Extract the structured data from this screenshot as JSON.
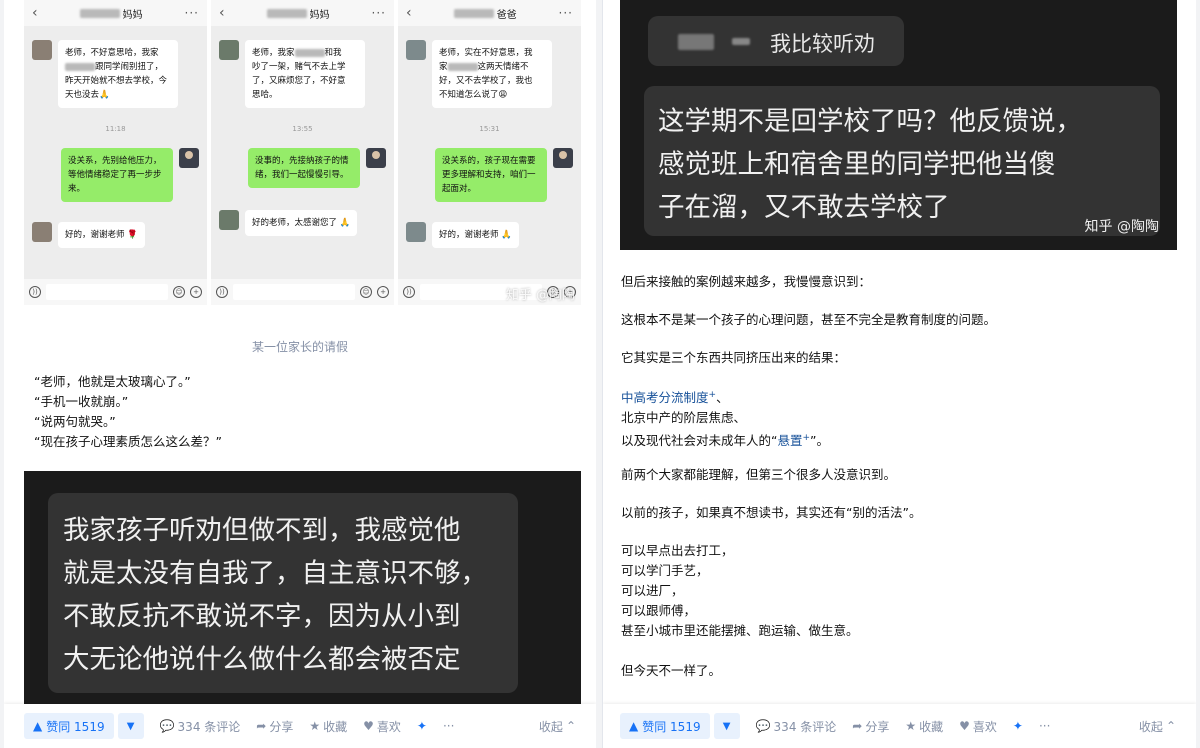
{
  "left": {
    "chats": [
      {
        "title_suffix": "妈妈",
        "parent_msg": [
          "老师，不好意思哈，我家",
          "跟同学闹别扭了，",
          "昨天开始就不想去学校，今",
          "天也没去🙏"
        ],
        "time": "11:18",
        "teacher_msg": [
          "没关系，先别给他压力，",
          "等他情绪稳定了再一步步",
          "来。"
        ],
        "parent_reply": "好的，谢谢老师 🌹"
      },
      {
        "title_suffix": "妈妈",
        "parent_msg": [
          "老师，我家",
          "和我",
          "吵了一架，赌气不去上学",
          "了，又麻烦您了，不好意",
          "思哈。"
        ],
        "time": "13:55",
        "teacher_msg": [
          "没事的，先接纳孩子的情",
          "绪，我们一起慢慢引导。"
        ],
        "parent_reply": "好的老师，太感谢您了 🙏"
      },
      {
        "title_suffix": "爸爸",
        "parent_msg": [
          "老师，实在不好意思，我",
          "家",
          "这两天情绪不",
          "好，又不去学校了，我也",
          "不知道怎么说了😩"
        ],
        "time": "15:31",
        "teacher_msg": [
          "没关系的，孩子现在需要",
          "更多理解和支持，咱们一",
          "起面对。"
        ],
        "parent_reply": "好的，谢谢老师 🙏"
      }
    ],
    "watermark": "知乎 @陶陶",
    "caption": "某一位家长的请假",
    "quotes": [
      "“老师，他就是太玻璃心了。”",
      "“手机一收就崩。”",
      "“说两句就哭。”",
      "“现在孩子心理素质怎么这么差？”"
    ],
    "dark_lines": [
      "我家孩子听劝但做不到，我感觉他",
      "就是太没有自我了，自主意识不够，",
      "不敢反抗不敢说不字，因为从小到",
      "大无论他说什么做什么都会被否定"
    ]
  },
  "right": {
    "top_bubble_text": "我比较听劝",
    "dark_lines": [
      "这学期不是回学校了吗？他反馈说，",
      "感觉班上和宿舍里的同学把他当傻",
      "子在溜，又不敢去学校了"
    ],
    "watermark": "知乎 @陶陶",
    "p1": "但后来接触的案例越来越多，我慢慢意识到：",
    "p2": "这根本不是某一个孩子的心理问题，甚至不完全是教育制度的问题。",
    "p3": "它其实是三个东西共同挤压出来的结果：",
    "list_link1": "中高考分流制度",
    "list_tail1": "、",
    "list2": "北京中产的阶层焦虑、",
    "list3_pre": "以及现代社会对未成年人的“",
    "list3_link": "悬置",
    "list3_post": "”。",
    "p4": "前两个大家都能理解，但第三个很多人没意识到。",
    "p5": "以前的孩子，如果真不想读书，其实还有“别的活法”。",
    "options": [
      "可以早点出去打工，",
      "可以学门手艺，",
      "可以进厂，",
      "可以跟师傅，",
      "甚至小城市里还能摆摊、跑运输、做生意。"
    ],
    "p6": "但今天不一样了。"
  },
  "actionbar": {
    "vote_label": "赞同 1519",
    "comments": "334 条评论",
    "share": "分享",
    "favorite": "收藏",
    "like": "喜欢",
    "more": "···",
    "collapse": "收起"
  }
}
